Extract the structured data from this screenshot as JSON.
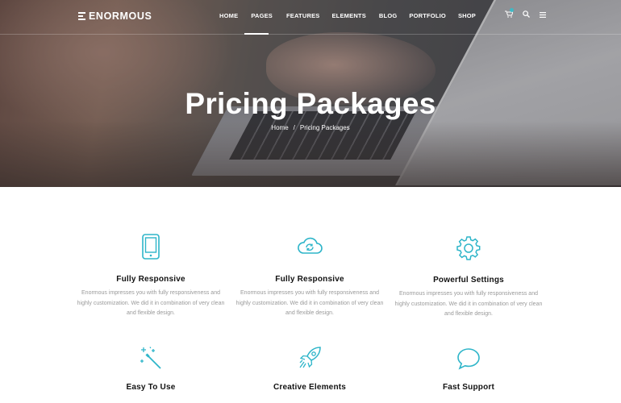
{
  "brand": {
    "name": "ENORMOUS"
  },
  "nav": {
    "items": [
      "HOME",
      "PAGES",
      "FEATURES",
      "ELEMENTS",
      "BLOG",
      "PORTFOLIO",
      "SHOP"
    ],
    "active": "PAGES",
    "icons": [
      "cart-icon",
      "search-icon",
      "menu-icon"
    ]
  },
  "hero": {
    "title": "Pricing Packages",
    "breadcrumb": {
      "home": "Home",
      "separator": "/",
      "current": "Pricing Packages"
    }
  },
  "features": [
    {
      "icon": "tablet-icon",
      "title": "Fully Responsive",
      "text": "Enormous impresses you with fully responsiveness and highly customization. We did it in combination of very clean and flexible design."
    },
    {
      "icon": "cloud-sync-icon",
      "title": "Fully Responsive",
      "text": "Enormous impresses you with fully responsiveness and highly customization. We did it in combination of very clean and flexible design."
    },
    {
      "icon": "gear-icon",
      "title": "Powerful Settings",
      "text": "Enormous impresses you with fully responsiveness and highly customization. We did it in combination of very clean and flexible design."
    },
    {
      "icon": "magic-wand-icon",
      "title": "Easy To Use",
      "text": ""
    },
    {
      "icon": "rocket-icon",
      "title": "Creative Elements",
      "text": ""
    },
    {
      "icon": "chat-bubble-icon",
      "title": "Fast Support",
      "text": ""
    }
  ],
  "colors": {
    "accent": "#2eb5c9",
    "text": "#111111",
    "muted": "#9a9a9a"
  }
}
